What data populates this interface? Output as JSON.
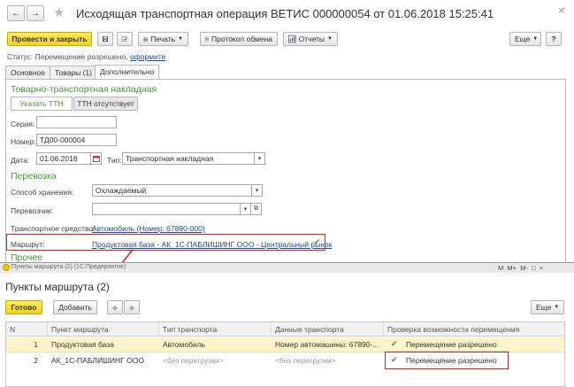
{
  "window": {
    "title": "Исходящая транспортная операция ВЕТИС 000000054 от 01.06.2018 15:25:41",
    "back_icon": "←",
    "forward_icon": "→",
    "star_icon": "★",
    "close_icon": "×"
  },
  "toolbar": {
    "post_and_close": "Провести и закрыть",
    "print": "Печать",
    "exchange_log": "Протокол обмена",
    "reports": "Отчеты",
    "more": "Еще",
    "help": "?"
  },
  "status": {
    "label": "Статус:",
    "value": "Перемещение разрешено,",
    "link": "оформите"
  },
  "tabs": [
    "Основное",
    "Товары (1)",
    "Дополнительно"
  ],
  "ttn": {
    "section": "Товарно-транспортная накладная",
    "btn_specify": "Указать ТТН",
    "btn_absent": "ТТН отсутствует",
    "series_label": "Серия:",
    "series_value": "",
    "number_label": "Номер:",
    "number_value": "ТД00-000004",
    "date_label": "Дата:",
    "date_value": "01.06.2018",
    "type_label": "Тип:",
    "type_value": "Транспортная накладная"
  },
  "transport": {
    "section": "Перевозка",
    "storage_label": "Способ хранения:",
    "storage_value": "Охлаждаемый",
    "carrier_label": "Перевозчик:",
    "carrier_value": "",
    "vehicle_label": "Транспортное средство:",
    "vehicle_value": "Автомобиль (Номер: 67890-000)",
    "route_label": "Маршрут:",
    "route_value": "Продуктовая база - АК_1С-ПАБЛИШИНГ ООО - Центральный рынок"
  },
  "other": {
    "section": "Прочее"
  },
  "subwindow": {
    "caption": "Пункты маршрута (2)  (1С:Предприятие)",
    "title": "Пункты маршрута (2)",
    "ready": "Готово",
    "add": "Добавить",
    "more": "Еще",
    "caption_buttons": "M  M+  M-  □  ×"
  },
  "table": {
    "columns": [
      "N",
      "Пункт маршрута",
      "Тип транспорта",
      "Данные транспорта",
      "Проверка возможности перемещения"
    ],
    "rows": [
      {
        "n": "1",
        "point": "Продуктовая база",
        "type": "Автомобиль",
        "data": "Номер автомашины: 67890-...",
        "check": "Перемещение разрешено"
      },
      {
        "n": "2",
        "point": "АК_1С-ПАБЛИШИНГ ООО",
        "type": "<без перегрузки>",
        "data": "<без перегрузки>",
        "check": "Перемещение разрешено"
      }
    ]
  },
  "colors": {
    "accent_green": "#4a9a3a",
    "link_blue": "#1a4ca0",
    "highlight_red": "#d42020",
    "selected_row": "#fdf5c9"
  }
}
